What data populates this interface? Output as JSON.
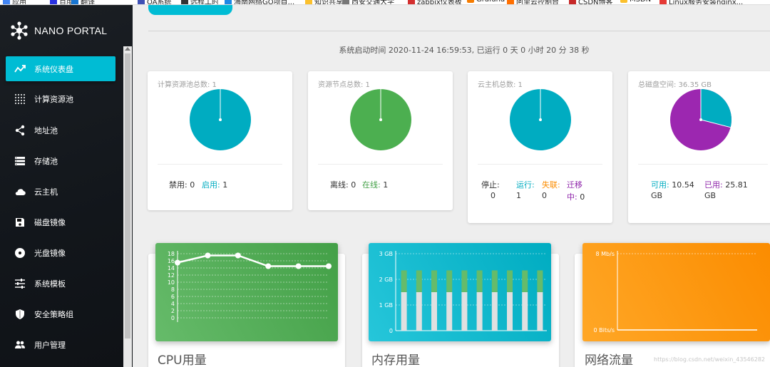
{
  "bookmarks": [
    {
      "label": "应用",
      "color": "#4285f4"
    },
    {
      "label": "百度",
      "color": "#2932e1"
    },
    {
      "label": "翻译",
      "color": "#1976d2"
    },
    {
      "label": "OA系统",
      "color": "#3f51b5"
    },
    {
      "label": "远程工时",
      "color": "#333333"
    },
    {
      "label": "海南网络GO项目...",
      "color": "#1e88e5"
    },
    {
      "label": "知识共享",
      "color": "#fbc02d"
    },
    {
      "label": "西安交通大学",
      "color": "#777777"
    },
    {
      "label": "zabbix仪表板",
      "color": "#d32f2f"
    },
    {
      "label": "Grafana",
      "color": "#f57c00"
    },
    {
      "label": "阿里云控制台",
      "color": "#ff6f00"
    },
    {
      "label": "CSDN博客",
      "color": "#c62828"
    },
    {
      "label": "MSDN",
      "color": "#fbc02d"
    },
    {
      "label": "Linux服务安装nginx...",
      "color": "#e53935"
    }
  ],
  "brand": {
    "name": "NANO PORTAL"
  },
  "nav": [
    {
      "label": "系统仪表盘",
      "icon": "chart-line-icon",
      "active": true
    },
    {
      "label": "计算资源池",
      "icon": "grid-icon"
    },
    {
      "label": "地址池",
      "icon": "share-icon"
    },
    {
      "label": "存储池",
      "icon": "storage-icon"
    },
    {
      "label": "云主机",
      "icon": "cloud-icon"
    },
    {
      "label": "磁盘镜像",
      "icon": "floppy-icon"
    },
    {
      "label": "光盘镜像",
      "icon": "disc-icon"
    },
    {
      "label": "系统模板",
      "icon": "sliders-icon"
    },
    {
      "label": "安全策略组",
      "icon": "shield-icon"
    },
    {
      "label": "用户管理",
      "icon": "users-icon"
    }
  ],
  "uptime": "系统启动时间 2020-11-24 16:59:53, 已运行 0 天 0 小时 20 分 38 秒",
  "cards": {
    "compute": {
      "title": "计算资源池总数: 1",
      "disabled_label": "禁用:",
      "disabled_value": "0",
      "enabled_label": "启用:",
      "enabled_value": "1",
      "enabled_ratio": 1.0
    },
    "nodes": {
      "title": "资源节点总数: 1",
      "offline_label": "离线:",
      "offline_value": "0",
      "online_label": "在线:",
      "online_value": "1",
      "online_ratio": 1.0
    },
    "vms": {
      "title": "云主机总数: 1",
      "stopped_label": "停止:",
      "stopped_value": "0",
      "running_label": "运行:",
      "running_value": "1",
      "lost_label": "失联:",
      "lost_value": "0",
      "migrating_label_1": "迁移",
      "migrating_label_2": "中:",
      "migrating_value": "0",
      "running_ratio": 1.0
    },
    "disk": {
      "title": "总磁盘空间: 36.35 GB",
      "available_label": "可用:",
      "available_value": "10.54",
      "available_unit": "GB",
      "used_label": "已用:",
      "used_value": "25.81",
      "used_unit": "GB",
      "available_ratio": 0.29
    }
  },
  "colors": {
    "cyan": "#00acc1",
    "green": "#4caf50",
    "purple": "#9c27b0",
    "orange": "#fb8c00",
    "sidebar_active": "#00bcd4"
  },
  "charts": {
    "cpu": {
      "title": "CPU用量",
      "y_ticks": [
        "18",
        "16",
        "14",
        "12",
        "10",
        "8",
        "6",
        "4",
        "2",
        "0"
      ],
      "chart_data": {
        "type": "line",
        "series": [
          {
            "values": [
              15.5,
              17.5,
              17.5,
              14.5,
              14.5,
              14.5
            ]
          }
        ],
        "ylim": [
          0,
          18
        ],
        "grid": true
      }
    },
    "memory": {
      "title": "内存用量",
      "y_ticks": [
        "3 GB",
        "2 GB",
        "1 GB",
        "0"
      ],
      "chart_data": {
        "type": "bar",
        "series": [
          {
            "values": [
              1.5,
              1.5,
              1.5,
              1.5,
              1.5,
              1.5,
              1.5,
              1.5,
              1.5,
              1.5
            ]
          },
          {
            "values": [
              0.85,
              0.85,
              0.85,
              0.85,
              0.85,
              0.85,
              0.85,
              0.85,
              0.85,
              0.85
            ]
          }
        ],
        "stacked": true,
        "ylim": [
          0,
          3
        ],
        "grid": true
      }
    },
    "network": {
      "title": "网络流量",
      "y_top": "8 Mb/s",
      "y_bottom": "0 Bits/s",
      "chart_data": {
        "type": "line",
        "series": [],
        "ylim": [
          "0 Bits/s",
          "8 Mb/s"
        ],
        "grid": true
      }
    }
  },
  "watermark": "https://blog.csdn.net/weixin_43546282"
}
